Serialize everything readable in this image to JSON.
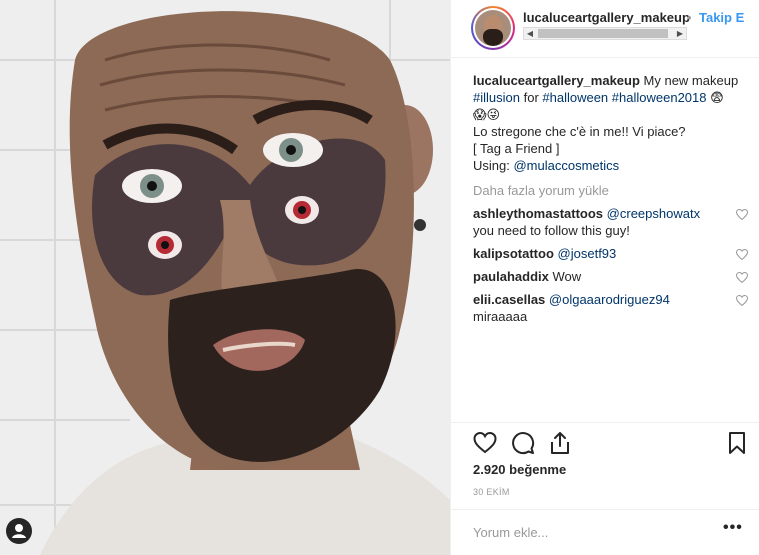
{
  "post": {
    "username": "lucaluceartgallery_makeup",
    "follow_label": "Takip E",
    "caption": {
      "line1_text": " My new makeup",
      "hashtag_illusion": "#illusion",
      "for_text": " for ",
      "hashtag_halloween": "#halloween",
      "hashtag_halloween2018": "#halloween2018",
      "emoji_line1": "😨",
      "emoji_line2": "😱😜",
      "line3": "Lo stregone che c'è in me!! Vi piace?",
      "line4": "[ Tag a Friend ]",
      "using_text": "Using: ",
      "using_mention": "@mulaccosmetics"
    },
    "load_more_label": "Daha fazla yorum yükle",
    "comments": [
      {
        "user": "ashleythomastattoos",
        "mention": "@creepshowatx",
        "text": "you need to follow this guy!"
      },
      {
        "user": "kalipsotattoo",
        "mention": "@josetf93",
        "text": ""
      },
      {
        "user": "paulahaddix",
        "mention": "",
        "text": "Wow"
      },
      {
        "user": "elii.casellas",
        "mention": "@olgaaarodriguez94",
        "text": "miraaaaa"
      }
    ],
    "likes": "2.920 beğenme",
    "date": "30 EKİM",
    "add_comment_placeholder": "Yorum ekle...",
    "more_options_label": "•••"
  },
  "icons": {
    "like": "heart-icon",
    "comment": "comment-icon",
    "share": "share-icon",
    "save": "bookmark-icon",
    "tag": "user-tag-icon"
  },
  "colors": {
    "link": "#003569",
    "follow": "#3897f0",
    "muted": "#999999",
    "text": "#262626"
  }
}
